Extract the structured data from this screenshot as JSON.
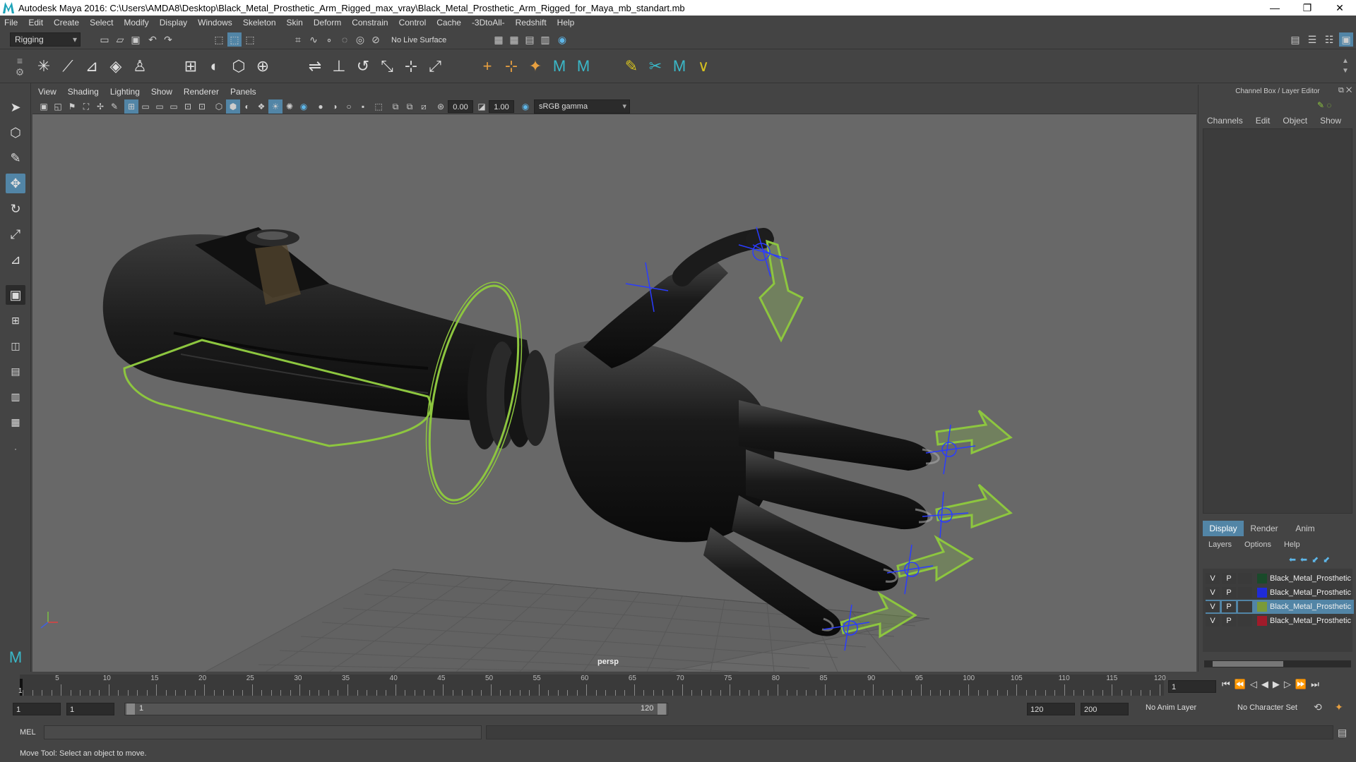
{
  "window": {
    "title": "Autodesk Maya 2016: C:\\Users\\AMDA8\\Desktop\\Black_Metal_Prosthetic_Arm_Rigged_max_vray\\Black_Metal_Prosthetic_Arm_Rigged_for_Maya_mb_standart.mb"
  },
  "menu": [
    "File",
    "Edit",
    "Create",
    "Select",
    "Modify",
    "Display",
    "Windows",
    "Skeleton",
    "Skin",
    "Deform",
    "Constrain",
    "Control",
    "Cache",
    "-3DtoAll-",
    "Redshift",
    "Help"
  ],
  "status": {
    "mode": "Rigging",
    "live_surface": "No Live Surface"
  },
  "viewport": {
    "menu": [
      "View",
      "Shading",
      "Lighting",
      "Show",
      "Renderer",
      "Panels"
    ],
    "near_value": "0.00",
    "far_value": "1.00",
    "color_space": "sRGB gamma",
    "camera_label": "persp"
  },
  "channelbox": {
    "title": "Channel Box / Layer Editor",
    "menu": [
      "Channels",
      "Edit",
      "Object",
      "Show"
    ]
  },
  "layer_editor": {
    "tabs": [
      "Display",
      "Render",
      "Anim"
    ],
    "menu": [
      "Layers",
      "Options",
      "Help"
    ],
    "layers": [
      {
        "v": "V",
        "p": "P",
        "name": "Black_Metal_Prosthetic",
        "color": "#1a4a2a"
      },
      {
        "v": "V",
        "p": "P",
        "name": "Black_Metal_Prosthetic",
        "color": "#1f2bd9"
      },
      {
        "v": "V",
        "p": "P",
        "name": "Black_Metal_Prosthetic",
        "color": "#7a9a3a"
      },
      {
        "v": "V",
        "p": "P",
        "name": "Black_Metal_Prosthetic",
        "color": "#a01b2a"
      }
    ]
  },
  "timeline": {
    "ticks": [
      "5",
      "10",
      "15",
      "20",
      "25",
      "30",
      "35",
      "40",
      "45",
      "50",
      "55",
      "60",
      "65",
      "70",
      "75",
      "80",
      "85",
      "90",
      "95",
      "100",
      "105",
      "110",
      "115",
      "120"
    ],
    "start_label": "1",
    "current_frame": "1"
  },
  "range": {
    "start": "1",
    "inner_start": "1",
    "slider_start": "1",
    "slider_end": "120",
    "end": "120",
    "max": "200",
    "anim_layer": "No Anim Layer",
    "char_set": "No Character Set"
  },
  "cmd": {
    "label": "MEL"
  },
  "help": {
    "text": "Move Tool: Select an object to move."
  },
  "colors": {
    "accent": "#5285a6",
    "rig_green": "#8dc63f",
    "joint_blue": "#2a3cff"
  }
}
